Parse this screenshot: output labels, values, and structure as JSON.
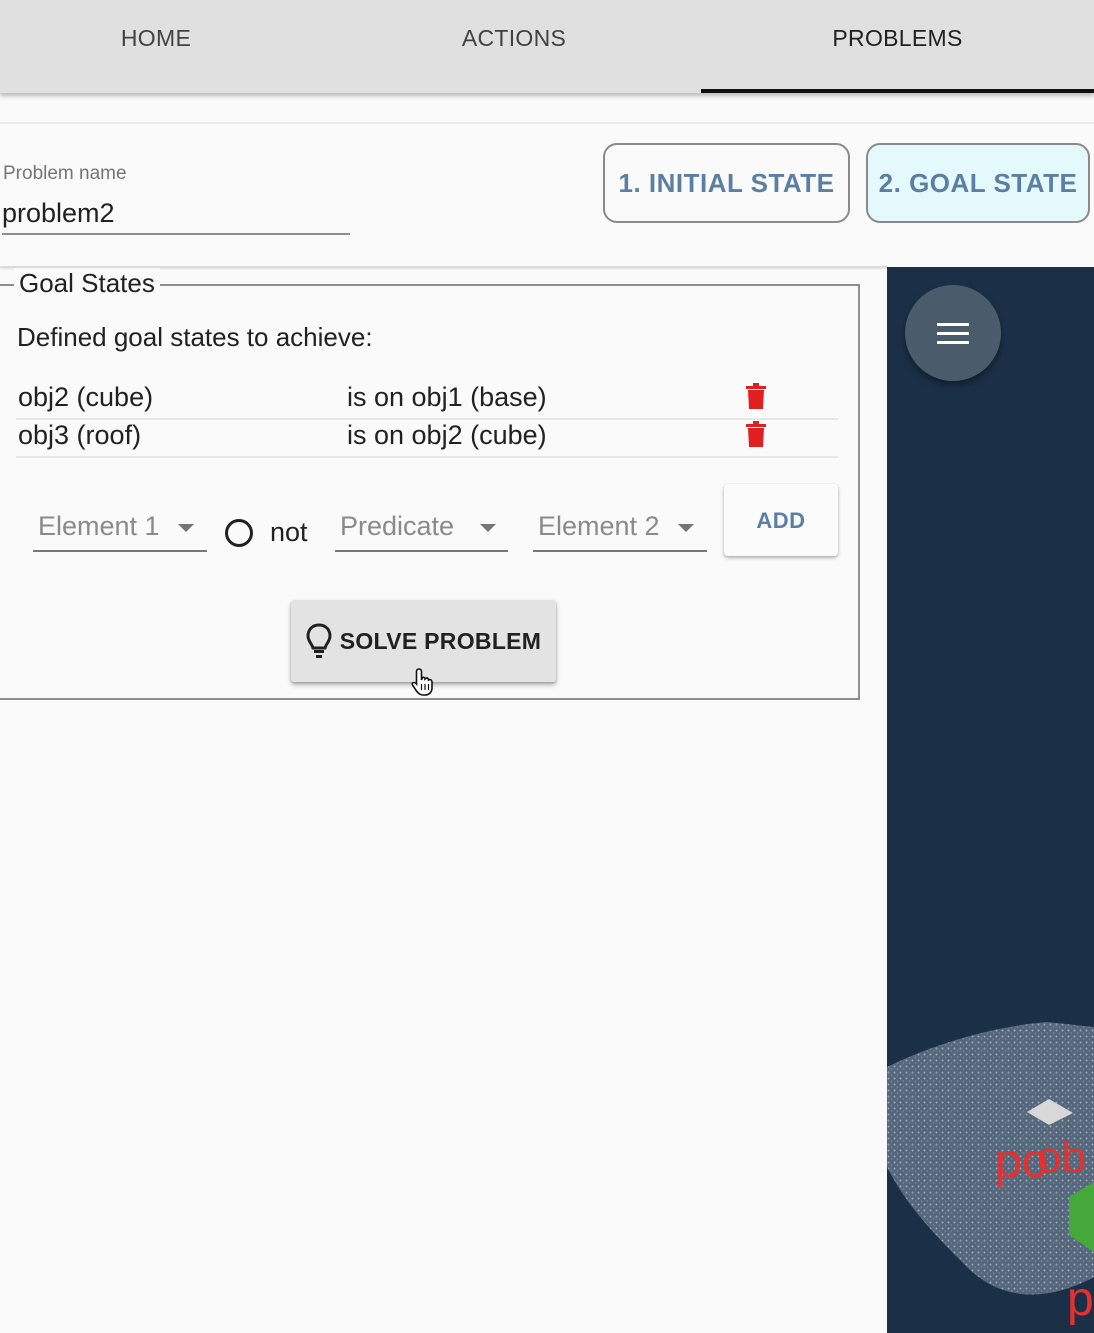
{
  "tabs": [
    {
      "label": "HOME"
    },
    {
      "label": "ACTIONS"
    },
    {
      "label": "PROBLEMS"
    }
  ],
  "active_tab": "PROBLEMS",
  "problem": {
    "name_label": "Problem name",
    "name_value": "problem2"
  },
  "state_buttons": {
    "initial": "1. INITIAL STATE",
    "goal": "2. GOAL STATE"
  },
  "goal_states": {
    "legend": "Goal States",
    "intro": "Defined goal states to achieve:",
    "rows": [
      {
        "element": "obj2 (cube)",
        "relation": "is on obj1 (base)"
      },
      {
        "element": "obj3 (roof)",
        "relation": "is on obj2 (cube)"
      }
    ]
  },
  "form": {
    "element1_placeholder": "Element 1",
    "not_label": "not",
    "predicate_placeholder": "Predicate",
    "element2_placeholder": "Element 2",
    "add_label": "ADD"
  },
  "solve": {
    "label": "SOLVE PROBLEM",
    "icon": "lightbulb-icon"
  },
  "viewer": {
    "menu_icon": "menu-icon"
  },
  "colors": {
    "accent_text": "#5b7fa3",
    "delete_icon": "#e02020",
    "viewer_bg": "#1b3047",
    "goal_button_bg": "#e3f9fc"
  }
}
